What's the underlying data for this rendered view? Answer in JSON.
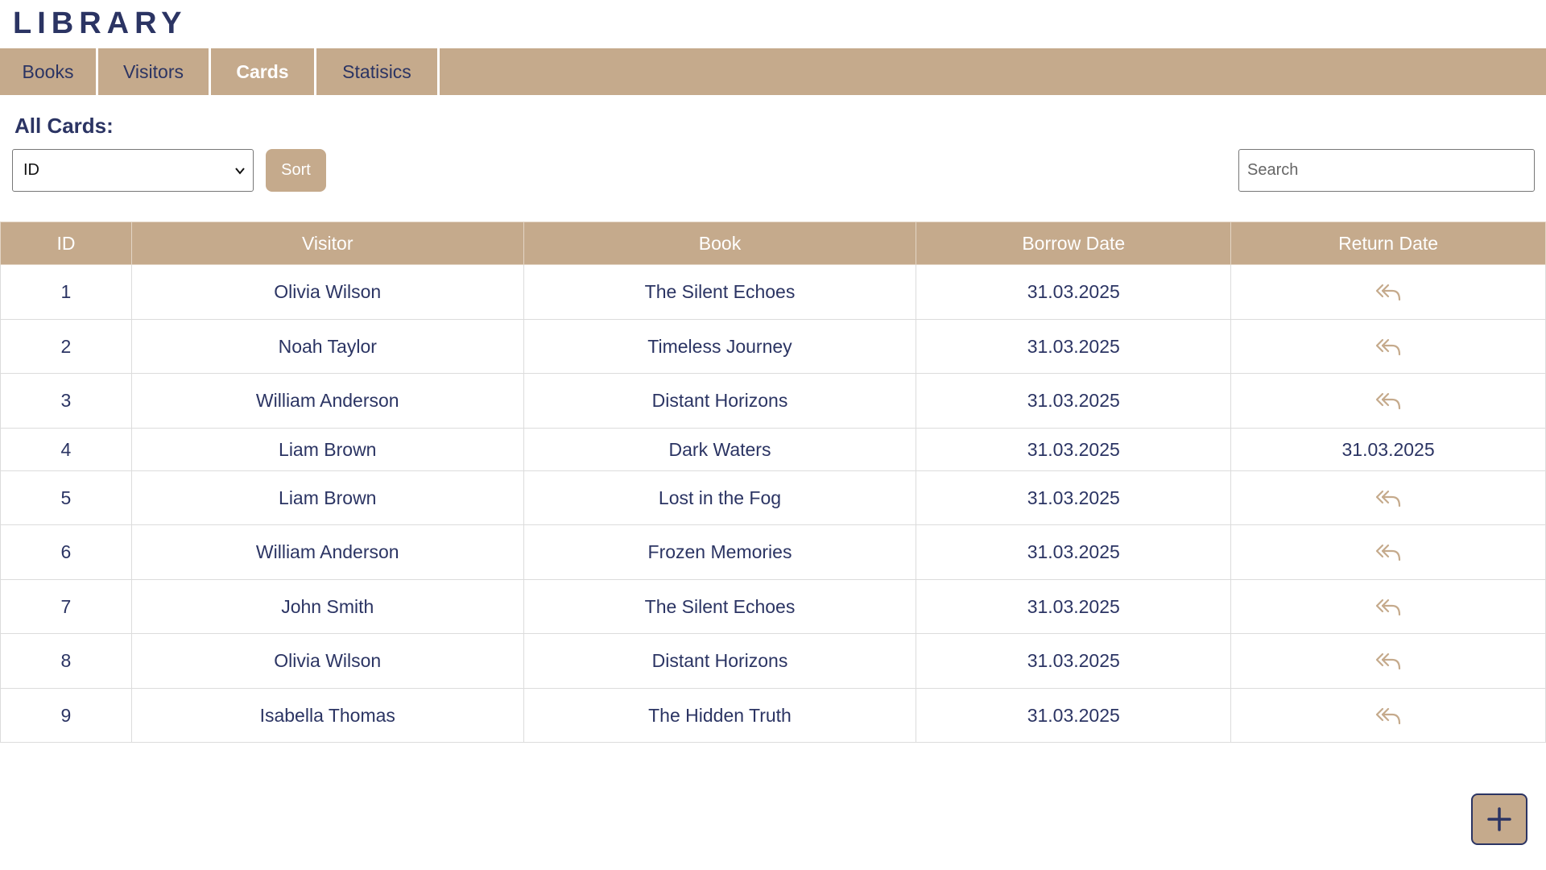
{
  "app": {
    "title": "LIBRARY"
  },
  "nav": {
    "tabs": [
      {
        "label": "Books"
      },
      {
        "label": "Visitors"
      },
      {
        "label": "Cards",
        "active": true
      },
      {
        "label": "Statisics"
      }
    ]
  },
  "page": {
    "title": "All Cards:"
  },
  "toolbar": {
    "sort_field": "ID",
    "sort_label": "Sort",
    "search_placeholder": "Search"
  },
  "table": {
    "columns": [
      "ID",
      "Visitor",
      "Book",
      "Borrow Date",
      "Return Date"
    ],
    "rows": [
      {
        "id": "1",
        "visitor": "Olivia Wilson",
        "book": "The Silent Echoes",
        "borrow_date": "31.03.2025",
        "return_date": ""
      },
      {
        "id": "2",
        "visitor": "Noah Taylor",
        "book": "Timeless Journey",
        "borrow_date": "31.03.2025",
        "return_date": ""
      },
      {
        "id": "3",
        "visitor": "William Anderson",
        "book": "Distant Horizons",
        "borrow_date": "31.03.2025",
        "return_date": ""
      },
      {
        "id": "4",
        "visitor": "Liam Brown",
        "book": "Dark Waters",
        "borrow_date": "31.03.2025",
        "return_date": "31.03.2025"
      },
      {
        "id": "5",
        "visitor": "Liam Brown",
        "book": "Lost in the Fog",
        "borrow_date": "31.03.2025",
        "return_date": ""
      },
      {
        "id": "6",
        "visitor": "William Anderson",
        "book": "Frozen Memories",
        "borrow_date": "31.03.2025",
        "return_date": ""
      },
      {
        "id": "7",
        "visitor": "John Smith",
        "book": "The Silent Echoes",
        "borrow_date": "31.03.2025",
        "return_date": ""
      },
      {
        "id": "8",
        "visitor": "Olivia Wilson",
        "book": "Distant Horizons",
        "borrow_date": "31.03.2025",
        "return_date": ""
      },
      {
        "id": "9",
        "visitor": "Isabella Thomas",
        "book": "The Hidden Truth",
        "borrow_date": "31.03.2025",
        "return_date": ""
      }
    ]
  },
  "icons": {
    "return": "reply-all-icon",
    "add": "plus-icon"
  },
  "colors": {
    "accent": "#c5aa8c",
    "text": "#2b3463",
    "active_tab_text": "#ffffff"
  }
}
